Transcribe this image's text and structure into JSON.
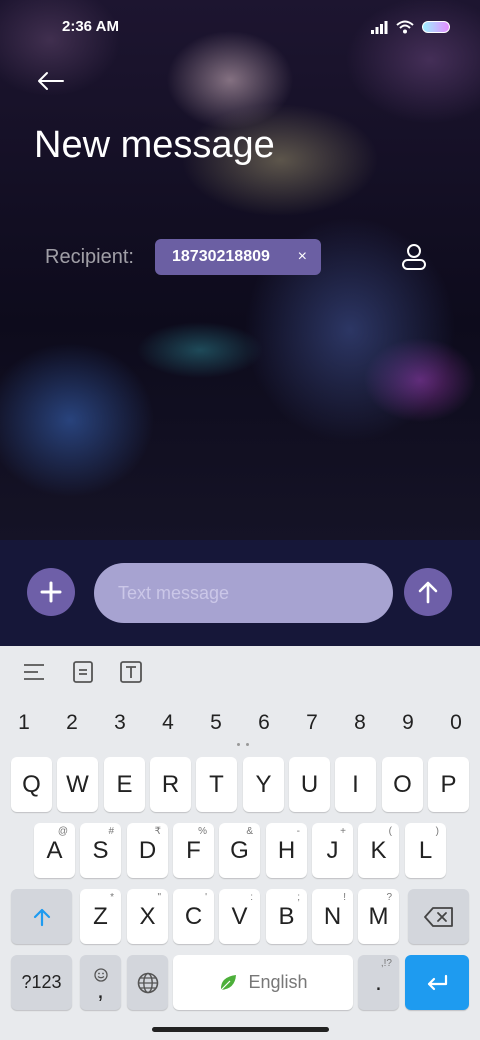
{
  "status": {
    "time": "2:36 AM"
  },
  "header": {
    "title": "New message"
  },
  "recipient": {
    "label": "Recipient:",
    "chip_text": "18730218809",
    "chip_close": "×"
  },
  "compose": {
    "placeholder": "Text message"
  },
  "keyboard": {
    "numbers": [
      "1",
      "2",
      "3",
      "4",
      "5",
      "6",
      "7",
      "8",
      "9",
      "0"
    ],
    "row1": [
      {
        "k": "Q"
      },
      {
        "k": "W"
      },
      {
        "k": "E"
      },
      {
        "k": "R"
      },
      {
        "k": "T"
      },
      {
        "k": "Y"
      },
      {
        "k": "U"
      },
      {
        "k": "I"
      },
      {
        "k": "O"
      },
      {
        "k": "P"
      }
    ],
    "row2": [
      {
        "k": "A",
        "h": "@"
      },
      {
        "k": "S",
        "h": "#"
      },
      {
        "k": "D",
        "h": "₹"
      },
      {
        "k": "F",
        "h": "%"
      },
      {
        "k": "G",
        "h": "&"
      },
      {
        "k": "H",
        "h": "-"
      },
      {
        "k": "J",
        "h": "+"
      },
      {
        "k": "K",
        "h": "("
      },
      {
        "k": "L",
        "h": ")"
      }
    ],
    "row3": [
      {
        "k": "Z",
        "h": "*"
      },
      {
        "k": "X",
        "h": "\""
      },
      {
        "k": "C",
        "h": "'"
      },
      {
        "k": "V",
        "h": ":"
      },
      {
        "k": "B",
        "h": ";"
      },
      {
        "k": "N",
        "h": "!"
      },
      {
        "k": "M",
        "h": "?"
      }
    ],
    "symbols_label": "?123",
    "comma_label": ",",
    "space_label": "English",
    "period_label": ".",
    "period_hint": ",!?"
  }
}
